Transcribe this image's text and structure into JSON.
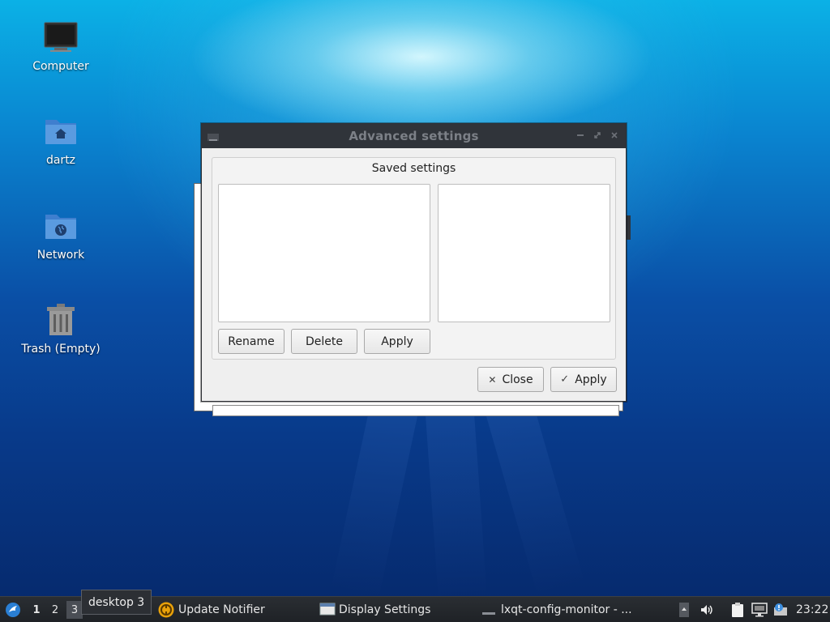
{
  "desktop": {
    "icons": [
      {
        "label": "Computer"
      },
      {
        "label": "dartz"
      },
      {
        "label": "Network"
      },
      {
        "label": "Trash (Empty)"
      }
    ]
  },
  "dialog": {
    "title": "Advanced settings",
    "group_title": "Saved settings",
    "rename_label": "Rename",
    "delete_label": "Delete",
    "group_apply_label": "Apply",
    "close_label": "Close",
    "apply_label": "Apply"
  },
  "taskbar": {
    "desktops": [
      "1",
      "2",
      "3"
    ],
    "tooltip": "desktop 3",
    "tasks": [
      {
        "label": "Update Notifier"
      },
      {
        "label": "Display Settings"
      },
      {
        "label": "lxqt-config-monitor - ..."
      }
    ],
    "clock": "23:22"
  },
  "colors": {
    "titlebar": "#30343a",
    "taskbar": "#1f2226",
    "accent": "#2a7fd4"
  }
}
